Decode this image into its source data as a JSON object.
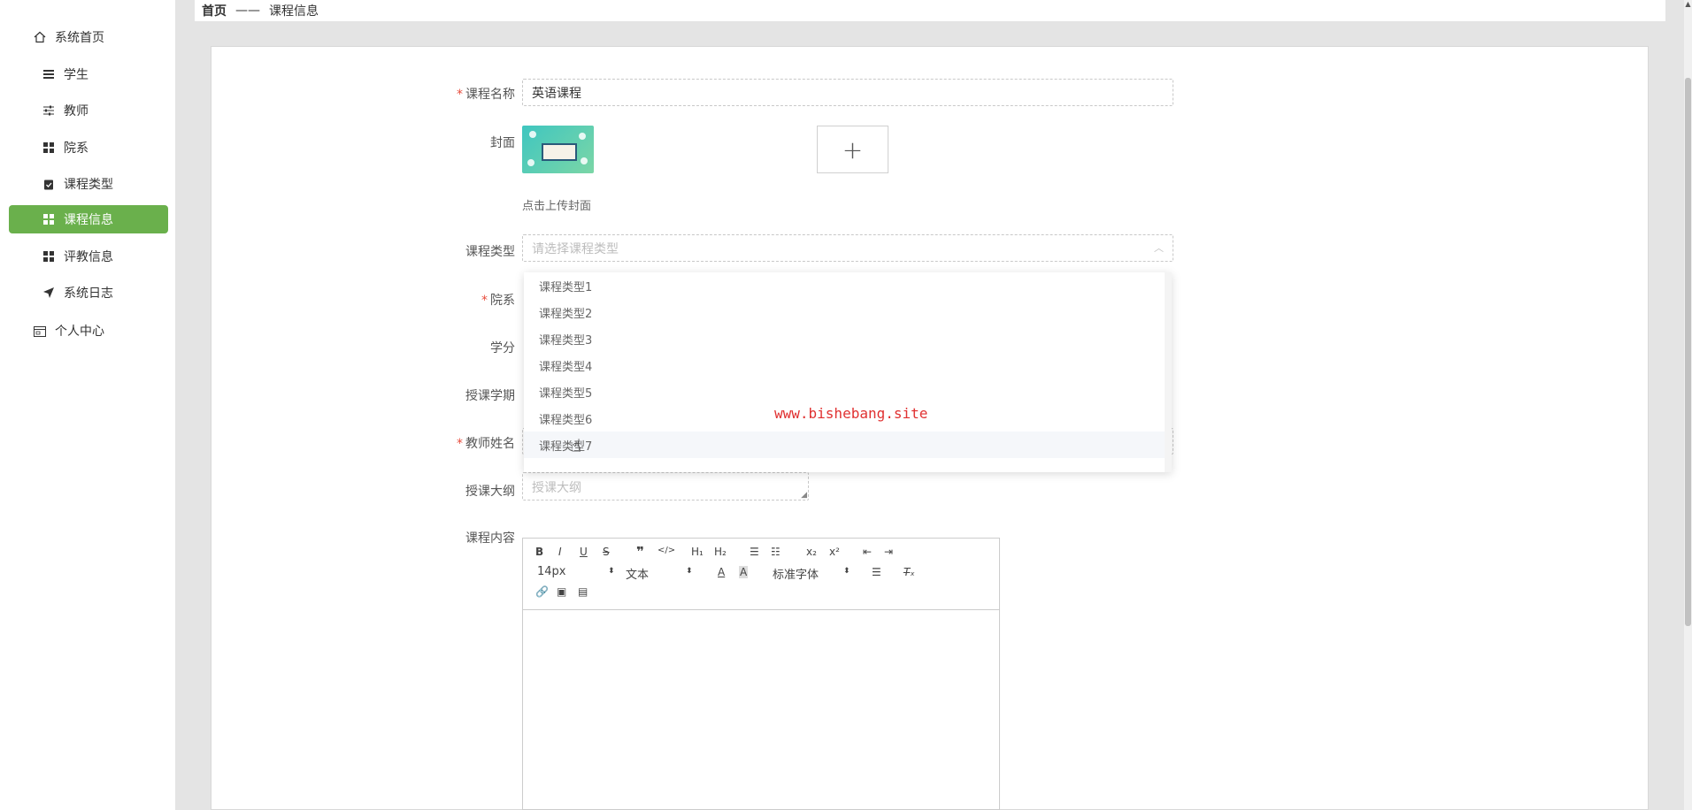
{
  "sidebar": {
    "items": [
      {
        "label": "系统首页",
        "icon": "home-icon"
      },
      {
        "label": "学生",
        "icon": "list-icon"
      },
      {
        "label": "教师",
        "icon": "sliders-icon"
      },
      {
        "label": "院系",
        "icon": "grid-icon"
      },
      {
        "label": "课程类型",
        "icon": "clipboard-icon"
      },
      {
        "label": "课程信息",
        "icon": "grid-icon",
        "active": true
      },
      {
        "label": "评教信息",
        "icon": "grid-icon"
      },
      {
        "label": "系统日志",
        "icon": "send-icon"
      },
      {
        "label": "个人中心",
        "icon": "calendar-icon"
      }
    ],
    "active_color": "#6ab04c"
  },
  "breadcrumb": {
    "home": "首页",
    "separator": "——",
    "current": "课程信息"
  },
  "form": {
    "course_name": {
      "label": "课程名称",
      "value": "英语课程",
      "required": true
    },
    "cover": {
      "label": "封面",
      "plus": "+",
      "hint": "点击上传封面"
    },
    "course_type": {
      "label": "课程类型",
      "placeholder": "请选择课程类型"
    },
    "department": {
      "label": "院系",
      "required": true
    },
    "credit": {
      "label": "学分"
    },
    "term": {
      "label": "授课学期"
    },
    "teacher_name": {
      "label": "教师姓名",
      "required": true
    },
    "syllabus": {
      "label": "授课大纲",
      "placeholder": "授课大纲"
    },
    "content": {
      "label": "课程内容"
    }
  },
  "dropdown": {
    "options": [
      "课程类型1",
      "课程类型2",
      "课程类型3",
      "课程类型4",
      "课程类型5",
      "课程类型6",
      "课程类型7"
    ],
    "hovered": "课程类型7"
  },
  "watermark": "www.bishebang.site",
  "editor": {
    "font_size": "14px",
    "header_select": "文本",
    "font_family": "标准字体"
  }
}
